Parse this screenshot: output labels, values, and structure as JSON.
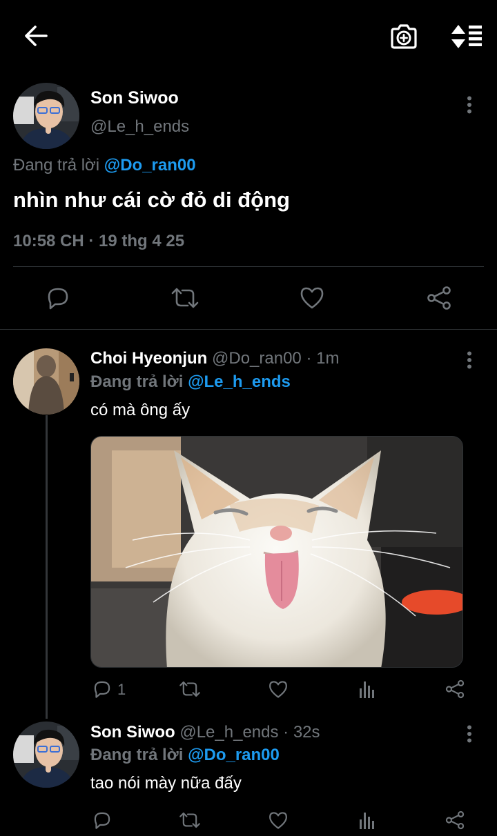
{
  "topbar": {
    "back_icon": "arrow-left-icon",
    "camera_icon": "camera-plus-icon",
    "sort_icon": "sort-list-icon"
  },
  "main_tweet": {
    "name": "Son Siwoo",
    "handle": "@Le_h_ends",
    "replying_prefix": "Đang trả lời",
    "replying_to": "@Do_ran00",
    "text": "nhìn như cái cờ đỏ di động",
    "timestamp": "10:58 CH · 19 thg 4 25"
  },
  "replies": [
    {
      "name": "Choi Hyeonjun",
      "handle": "@Do_ran00",
      "time": "· 1m",
      "replying_prefix": "Đang trả lời",
      "replying_to": "@Le_h_ends",
      "text": "có mà ông ấy",
      "reply_count": "1"
    },
    {
      "name": "Son Siwoo",
      "handle": "@Le_h_ends",
      "time": "· 32s",
      "replying_prefix": "Đang trả lời",
      "replying_to": "@Do_ran00",
      "text": "tao nói mày nữa đấy"
    }
  ],
  "colors": {
    "background": "#000000",
    "text": "#e7e9ea",
    "muted": "#71767b",
    "accent": "#1d9bf0"
  }
}
